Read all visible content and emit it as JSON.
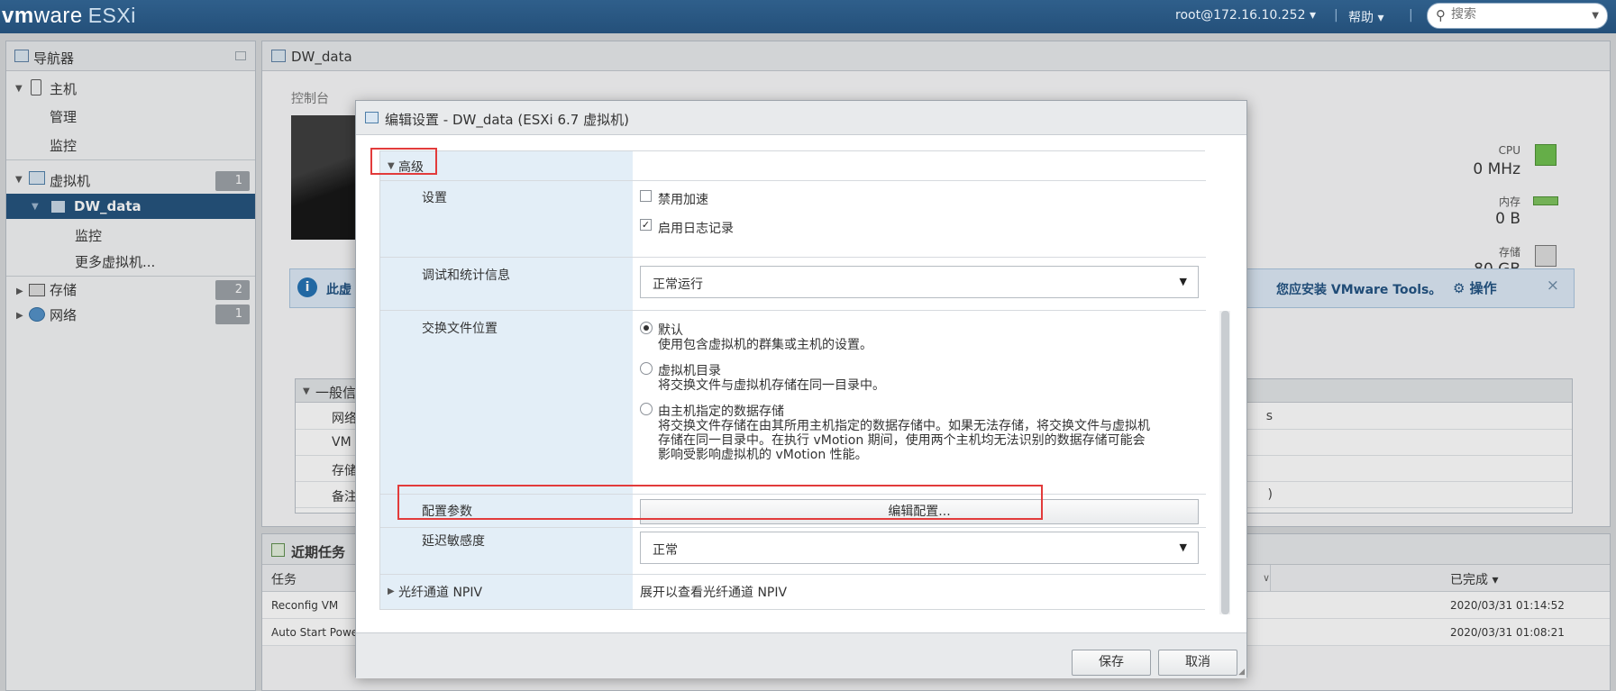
{
  "topbar": {
    "logo_vm": "vm",
    "logo_ware": "ware",
    "logo_esxi": "ESXi",
    "user": "root@172.16.10.252 ▾",
    "sep": "|",
    "help": "帮助 ▾",
    "search_placeholder": "搜索"
  },
  "navigator": {
    "title": "导航器",
    "host": "主机",
    "manage": "管理",
    "monitor": "监控",
    "vms": "虚拟机",
    "vms_count": "1",
    "vm_name": "DW_data",
    "vm_monitor": "监控",
    "more_vms": "更多虚拟机...",
    "storage": "存储",
    "storage_count": "2",
    "network": "网络",
    "network_count": "1"
  },
  "main": {
    "title": "DW_data",
    "toolbar_console": "控制台",
    "cpu_label": "CPU",
    "cpu_value": "0 MHz",
    "mem_label": "内存",
    "mem_value": "0 B",
    "storage_label": "存储",
    "storage_value": "80 GB",
    "info_left": "此虚",
    "info_right": "您应安装 VMware Tools。",
    "info_action": "操作",
    "general_title": "一般信",
    "general_rows": [
      "网络",
      "VM",
      "存储",
      "备注"
    ],
    "general_right": "s",
    "general_right2": ")"
  },
  "tasks": {
    "title": "近期任务",
    "col_task": "任务",
    "col_done": "已完成 ▾",
    "rows": [
      {
        "task": "Reconfig VM",
        "done": "2020/03/31 01:14:52"
      },
      {
        "task": "Auto Start Power",
        "done": "2020/03/31 01:08:21"
      }
    ]
  },
  "dialog": {
    "title": "编辑设置 - DW_data (ESXi 6.7 虚拟机)",
    "advanced": "高级",
    "settings_label": "设置",
    "disable_accel": "禁用加速",
    "enable_logging": "启用日志记录",
    "debug_label": "调试和统计信息",
    "debug_value": "正常运行",
    "swap_label": "交换文件位置",
    "swap_opt1": "默认",
    "swap_opt1_desc": "使用包含虚拟机的群集或主机的设置。",
    "swap_opt2": "虚拟机目录",
    "swap_opt2_desc": "将交换文件与虚拟机存储在同一目录中。",
    "swap_opt3": "由主机指定的数据存储",
    "swap_opt3_desc1": "将交换文件存储在由其所用主机指定的数据存储中。如果无法存储，将交换文件与虚拟机",
    "swap_opt3_desc2": "存储在同一目录中。在执行 vMotion 期间，使用两个主机均无法识别的数据存储可能会",
    "swap_opt3_desc3": "影响受影响虚拟机的 vMotion 性能。",
    "config_label": "配置参数",
    "edit_config": "编辑配置...",
    "latency_label": "延迟敏感度",
    "latency_value": "正常",
    "npiv_label": "光纤通道 NPIV",
    "npiv_value": "展开以查看光纤通道 NPIV",
    "save": "保存",
    "cancel": "取消"
  }
}
